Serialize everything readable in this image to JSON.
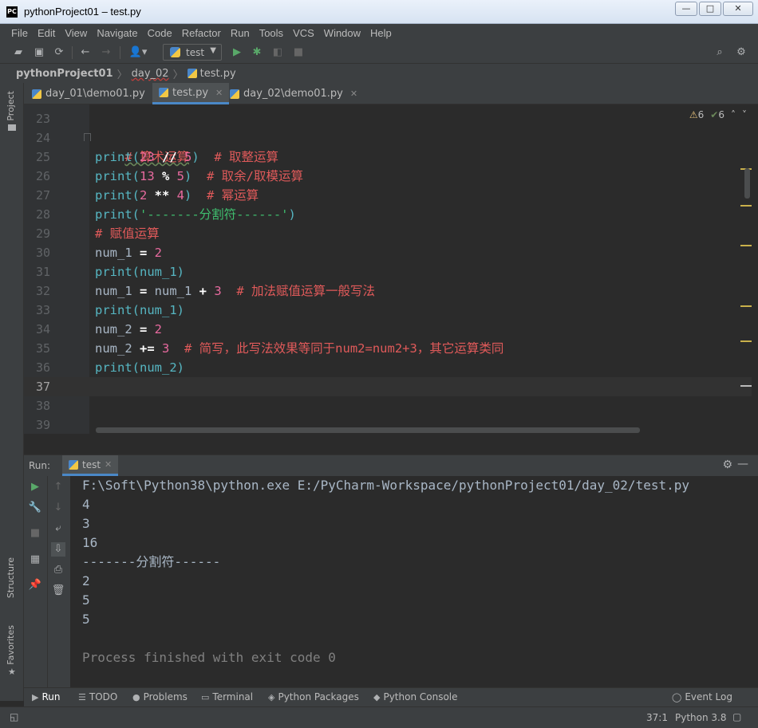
{
  "window": {
    "title": "pythonProject01 – test.py",
    "app_icon": "PC",
    "minimize": "—",
    "maximize": "□",
    "close": "✕"
  },
  "menu": [
    "File",
    "Edit",
    "View",
    "Navigate",
    "Code",
    "Refactor",
    "Run",
    "Tools",
    "VCS",
    "Window",
    "Help"
  ],
  "toolbar": {
    "run_config": "test"
  },
  "breadcrumb": {
    "project": "pythonProject01",
    "folder": "day_02",
    "file": "test.py"
  },
  "left_strip": {
    "project": "Project",
    "structure": "Structure",
    "favorites": "Favorites"
  },
  "tabs": [
    {
      "label": "day_01\\demo01.py"
    },
    {
      "label": "test.py"
    },
    {
      "label": "day_02\\demo01.py"
    }
  ],
  "inspections": {
    "warnings": "6",
    "ok": "6"
  },
  "editor": {
    "line_numbers": [
      "23",
      "24",
      "25",
      "26",
      "27",
      "28",
      "29",
      "30",
      "31",
      "32",
      "33",
      "34",
      "35",
      "36",
      "37",
      "38",
      "39"
    ],
    "current_line": "37",
    "lines": {
      "l24_comment": "# 算术运算",
      "l25_a": "print(",
      "l25_b": "23",
      "l25_c": " // ",
      "l25_d": "5",
      "l25_e": ")  ",
      "l25_f": "# 取整运算",
      "l26_a": "print(",
      "l26_b": "13",
      "l26_c": " % ",
      "l26_d": "5",
      "l26_e": ")  ",
      "l26_f": "# 取余/取模运算",
      "l27_a": "print(",
      "l27_b": "2",
      "l27_c": " ** ",
      "l27_d": "4",
      "l27_e": ")  ",
      "l27_f": "# 幂运算",
      "l28_a": "print(",
      "l28_b": "'-------分割符------'",
      "l28_c": ")",
      "l29_comment": "# 赋值运算",
      "l30_a": "num_1",
      "l30_b": " = ",
      "l30_c": "2",
      "l31": "print(num_1)",
      "l32_a": "num_1",
      "l32_b": " = ",
      "l32_c": "num_1",
      "l32_d": " + ",
      "l32_e": "3",
      "l32_f": "  # 加法赋值运算一般写法",
      "l33": "print(num_1)",
      "l34_a": "num_2",
      "l34_b": " = ",
      "l34_c": "2",
      "l35_a": "num_2",
      "l35_b": " += ",
      "l35_c": "3",
      "l35_d": "  # 简写，此写法效果等同于num2=num2+3，其它运算类同",
      "l36": "print(num_2)"
    }
  },
  "run_panel": {
    "label": "Run:",
    "tab": "test",
    "output": [
      "F:\\Soft\\Python38\\python.exe E:/PyCharm-Workspace/pythonProject01/day_02/test.py",
      "4",
      "3",
      "16",
      "-------分割符------",
      "2",
      "5",
      "5",
      "",
      "Process finished with exit code 0"
    ]
  },
  "bottom_tabs": [
    "Run",
    "TODO",
    "Problems",
    "Terminal",
    "Python Packages",
    "Python Console"
  ],
  "event_log": "Event Log",
  "status": {
    "position": "37:1",
    "interpreter": "Python 3.8"
  }
}
